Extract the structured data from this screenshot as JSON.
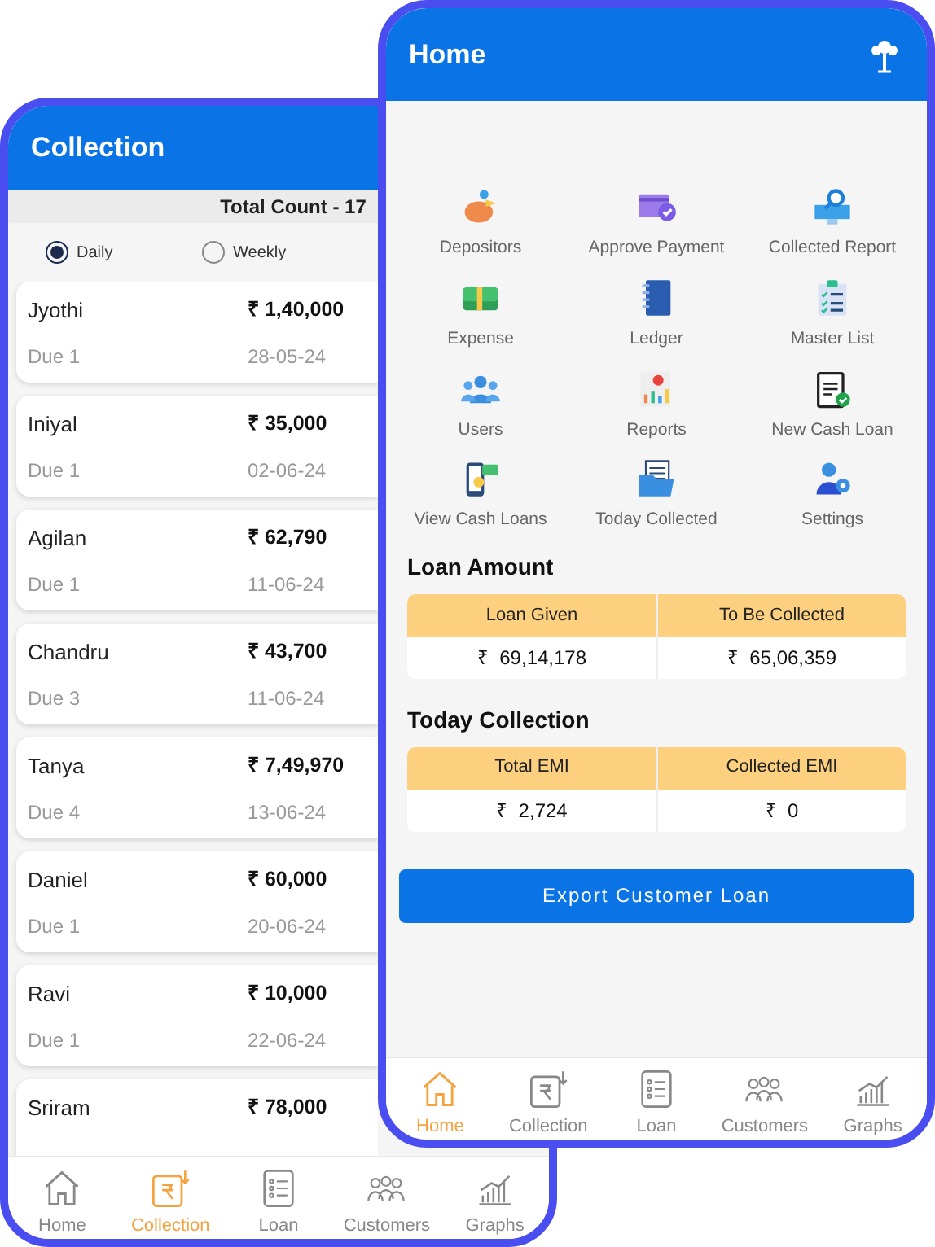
{
  "collection_screen": {
    "title": "Collection",
    "total_count": "Total Count - 17",
    "frequency": [
      {
        "label": "Daily",
        "selected": true
      },
      {
        "label": "Weekly",
        "selected": false
      }
    ],
    "entries": [
      {
        "name": "Jyothi",
        "amount": "₹ 1,40,000",
        "due": "Due 1",
        "date": "28-05-24"
      },
      {
        "name": "Iniyal",
        "amount": "₹ 35,000",
        "due": "Due 1",
        "date": "02-06-24"
      },
      {
        "name": "Agilan",
        "amount": "₹ 62,790",
        "due": "Due 1",
        "date": "11-06-24"
      },
      {
        "name": "Chandru",
        "amount": "₹ 43,700",
        "due": "Due 3",
        "date": "11-06-24"
      },
      {
        "name": "Tanya",
        "amount": "₹ 7,49,970",
        "due": "Due 4",
        "date": "13-06-24"
      },
      {
        "name": "Daniel",
        "amount": "₹ 60,000",
        "due": "Due 1",
        "date": "20-06-24"
      },
      {
        "name": "Ravi",
        "amount": "₹ 10,000",
        "due": "Due 1",
        "date": "22-06-24"
      },
      {
        "name": "Sriram",
        "amount": "₹ 78,000"
      }
    ],
    "nav": [
      {
        "label": "Home",
        "selected": false
      },
      {
        "label": "Collection",
        "selected": true
      },
      {
        "label": "Loan",
        "selected": false
      },
      {
        "label": "Customers",
        "selected": false
      },
      {
        "label": "Graphs",
        "selected": false
      }
    ]
  },
  "home_screen": {
    "title": "Home",
    "menu": [
      "Depositors",
      "Approve Payment",
      "Collected Report",
      "Expense",
      "Ledger",
      "Master List",
      "Users",
      "Reports",
      "New Cash Loan",
      "View Cash Loans",
      "Today Collected",
      "Settings"
    ],
    "loan_amount": {
      "title": "Loan Amount",
      "columns": [
        "Loan Given",
        "To Be Collected"
      ],
      "values": [
        "₹  69,14,178",
        "₹  65,06,359"
      ]
    },
    "today_collection": {
      "title": "Today Collection",
      "columns": [
        "Total EMI",
        "Collected EMI"
      ],
      "values": [
        "₹  2,724",
        "₹  0"
      ]
    },
    "export_button": "Export Customer Loan",
    "nav": [
      {
        "label": "Home",
        "selected": true
      },
      {
        "label": "Collection",
        "selected": false
      },
      {
        "label": "Loan",
        "selected": false
      },
      {
        "label": "Customers",
        "selected": false
      },
      {
        "label": "Graphs",
        "selected": false
      }
    ]
  }
}
